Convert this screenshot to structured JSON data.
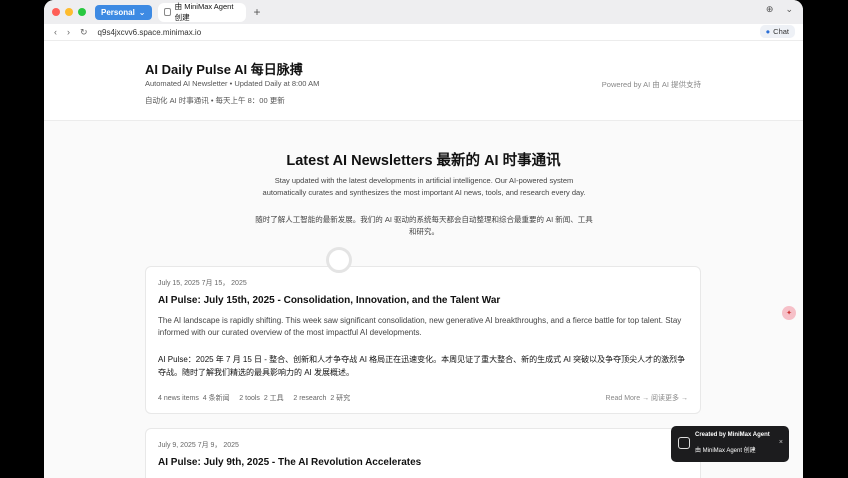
{
  "browser": {
    "profile": "Personal",
    "tab_title": "由 MiniMax Agent 创建",
    "new_tab": "+",
    "url": "q9s4jxcvv6.space.minimax.io",
    "chat_label": "Chat",
    "traffic_colors": [
      "#ff5f57",
      "#febc2e",
      "#28c840"
    ]
  },
  "header": {
    "title": "AI Daily Pulse  AI 每日脉搏",
    "subtitle_en": "Automated AI Newsletter • Updated Daily at 8:00 AM",
    "subtitle_cn": "自动化 AI 时事通讯 • 每天上午 8：00 更新",
    "powered": "Powered by AI  由 AI 提供支持"
  },
  "main": {
    "title": "Latest AI Newsletters  最新的 AI 时事通讯",
    "desc_en": "Stay updated with the latest developments in artificial intelligence. Our AI-powered system automatically curates and synthesizes the most important AI news, tools, and research every day.",
    "desc_cn": "随时了解人工智能的最新发展。我们的 AI 驱动的系统每天都会自动整理和综合最重要的 AI 新闻、工具和研究。"
  },
  "cards": [
    {
      "date": "July 15, 2025  7月 15，  2025",
      "title": "AI Pulse: July 15th, 2025 - Consolidation, Innovation, and the Talent War",
      "desc_en": "The AI landscape is rapidly shifting. This week saw significant consolidation, new generative AI breakthroughs, and a fierce battle for top talent. Stay informed with our curated overview of the most impactful AI developments.",
      "desc_cn": "AI Pulse：2025 年 7 月 15 日 - 整合、创新和人才争夺战 AI 格局正在迅速变化。本周见证了重大整合、新的生成式 AI 突破以及争夺顶尖人才的激烈争夺战。随时了解我们精选的最具影响力的 AI 发展概述。",
      "meta": "4 news items  4 条新闻     2 tools  2 工具     2 research  2 研究",
      "more": "Read More →  阅读更多 →"
    },
    {
      "date": "July 9, 2025  7月 9，  2025",
      "title": "AI Pulse: July 9th, 2025 - The AI Revolution Accelerates"
    }
  ],
  "toast": {
    "line1": "Created by MiniMax Agent",
    "line2": "由 MiniMax Agent 创建",
    "close": "×"
  }
}
